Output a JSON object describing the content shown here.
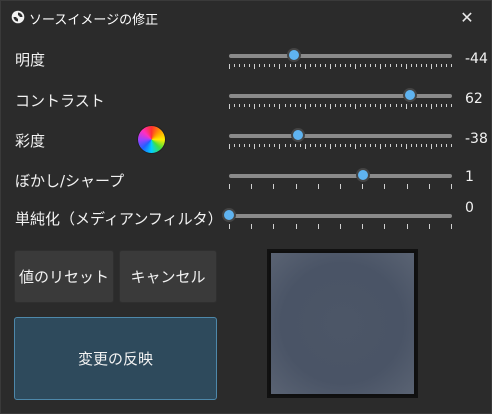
{
  "window": {
    "title": "ソースイメージの修正",
    "close_glyph": "✕"
  },
  "adjustments": {
    "brightness": {
      "label": "明度",
      "value": "-44",
      "position": 0.29
    },
    "contrast": {
      "label": "コントラスト",
      "value": "62",
      "position": 0.81
    },
    "saturation": {
      "label": "彩度",
      "value": "-38",
      "position": 0.31
    },
    "blur_sharpen": {
      "label": "ぼかし/シャープ",
      "value": "1",
      "position": 0.6
    },
    "median": {
      "label": "単純化（メディアンフィルタ）",
      "value": "0",
      "position": 0.0
    }
  },
  "buttons": {
    "reset": "値のリセット",
    "cancel": "キャンセル",
    "apply": "変更の反映"
  },
  "colors": {
    "accent": "#5fb3f0",
    "apply_bg": "#2e4a5c"
  },
  "icons": {
    "app": "app-icon",
    "close": "close-icon",
    "saturation": "color-wheel-icon"
  }
}
